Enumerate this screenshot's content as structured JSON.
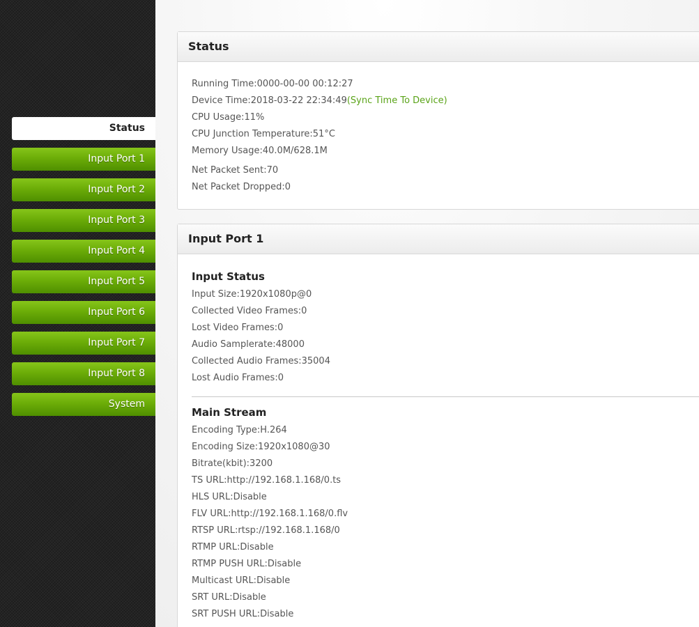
{
  "sidebar": {
    "items": [
      {
        "label": "Status",
        "active": true
      },
      {
        "label": "Input Port 1"
      },
      {
        "label": "Input Port 2"
      },
      {
        "label": "Input Port 3"
      },
      {
        "label": "Input Port 4"
      },
      {
        "label": "Input Port 5"
      },
      {
        "label": "Input Port 6"
      },
      {
        "label": "Input Port 7"
      },
      {
        "label": "Input Port 8"
      },
      {
        "label": "System"
      }
    ]
  },
  "status_panel": {
    "title": "Status",
    "running_time": "Running Time:0000-00-00 00:12:27",
    "device_time": "Device Time:2018-03-22 22:34:49",
    "sync_link": "(Sync Time To Device)",
    "cpu_usage": "CPU Usage:11%",
    "cpu_temp": "CPU Junction Temperature:51°C",
    "memory": "Memory Usage:40.0M/628.1M",
    "net_sent": "Net Packet Sent:70",
    "net_dropped": "Net Packet Dropped:0"
  },
  "input_port_panel": {
    "title": "Input Port 1",
    "input_status": {
      "title": "Input Status",
      "rows": [
        "Input Size:1920x1080p@0",
        "Collected Video Frames:0",
        "Lost Video Frames:0",
        "Audio Samplerate:48000",
        "Collected Audio Frames:35004",
        "Lost Audio Frames:0"
      ]
    },
    "main_stream": {
      "title": "Main Stream",
      "rows": [
        "Encoding Type:H.264",
        "Encoding Size:1920x1080@30",
        "Bitrate(kbit):3200",
        "TS URL:http://192.168.1.168/0.ts",
        "HLS URL:Disable",
        "FLV URL:http://192.168.1.168/0.flv",
        "RTSP URL:rtsp://192.168.1.168/0",
        "RTMP URL:Disable",
        "RTMP PUSH URL:Disable",
        "Multicast URL:Disable",
        "SRT URL:Disable",
        "SRT PUSH URL:Disable"
      ]
    }
  },
  "colors": {
    "nav_green": "#6cad08",
    "link_green": "#5aa318"
  }
}
